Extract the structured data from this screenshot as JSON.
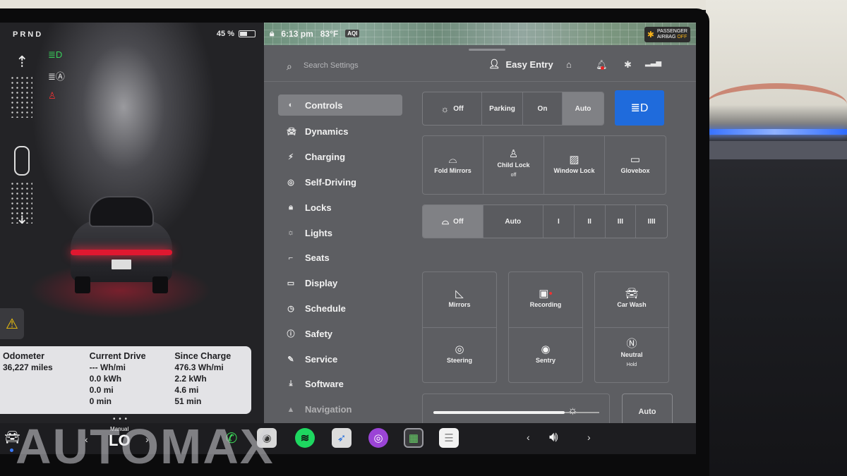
{
  "left_panel": {
    "gear": "PRND",
    "battery_percent": "45 %",
    "battery_level": 0.45,
    "stats": {
      "odometer": {
        "label": "Odometer",
        "values": [
          "36,227 miles"
        ]
      },
      "current_drive": {
        "label": "Current Drive",
        "values": [
          "--- Wh/mi",
          "0.0 kWh",
          "0.0 mi",
          "0 min"
        ]
      },
      "since_charge": {
        "label": "Since Charge",
        "values": [
          "476.3 Wh/mi",
          "2.2 kWh",
          "4.6 mi",
          "51 min"
        ]
      }
    },
    "icons": [
      "headlight-icon",
      "auto-highbeam-icon",
      "seatbelt-warning-icon",
      "warning-icon"
    ]
  },
  "status_bar": {
    "time": "6:13 pm",
    "temperature": "83°F",
    "aqi": "AQI",
    "airbag_line1": "PASSENGER",
    "airbag_line2": "AIRBAG",
    "airbag_state": "OFF"
  },
  "header": {
    "search_placeholder": "Search Settings",
    "profile_name": "Easy Entry"
  },
  "nav": [
    {
      "label": "Controls",
      "icon": "toggle-icon",
      "active": true
    },
    {
      "label": "Dynamics",
      "icon": "car-icon"
    },
    {
      "label": "Charging",
      "icon": "bolt-icon"
    },
    {
      "label": "Self-Driving",
      "icon": "steering-wheel-icon"
    },
    {
      "label": "Locks",
      "icon": "lock-icon"
    },
    {
      "label": "Lights",
      "icon": "light-icon"
    },
    {
      "label": "Seats",
      "icon": "seat-icon"
    },
    {
      "label": "Display",
      "icon": "display-icon"
    },
    {
      "label": "Schedule",
      "icon": "clock-icon"
    },
    {
      "label": "Safety",
      "icon": "safety-icon"
    },
    {
      "label": "Service",
      "icon": "wrench-icon"
    },
    {
      "label": "Software",
      "icon": "download-icon"
    },
    {
      "label": "Navigation",
      "icon": "navigation-icon"
    }
  ],
  "controls": {
    "headlights": {
      "options": [
        "Off",
        "Parking",
        "On",
        "Auto"
      ],
      "selected": "Auto"
    },
    "quick": [
      {
        "label": "Fold Mirrors",
        "sub": ""
      },
      {
        "label": "Child Lock",
        "sub": "off"
      },
      {
        "label": "Window Lock",
        "sub": ""
      },
      {
        "label": "Glovebox",
        "sub": ""
      }
    ],
    "wipers": {
      "options": [
        "Off",
        "Auto",
        "I",
        "II",
        "III",
        "IIII"
      ],
      "selected": "Off"
    },
    "adjust": [
      {
        "label": "Mirrors",
        "sub": ""
      },
      {
        "label": "Steering",
        "sub": ""
      },
      {
        "label": "Recording",
        "sub": ""
      },
      {
        "label": "Sentry",
        "sub": ""
      },
      {
        "label": "Car Wash",
        "sub": ""
      },
      {
        "label": "Neutral",
        "sub": "Hold"
      }
    ],
    "brightness_level": 0.79,
    "brightness_auto": "Auto"
  },
  "dock": {
    "climate_label": "Manual",
    "climate_value": "LO",
    "apps": [
      "phone-icon",
      "camera-icon",
      "spotify-icon",
      "navigation-app-icon",
      "podcast-icon",
      "app-launcher-icon",
      "notes-icon"
    ]
  },
  "watermark": "AUTOMAX"
}
